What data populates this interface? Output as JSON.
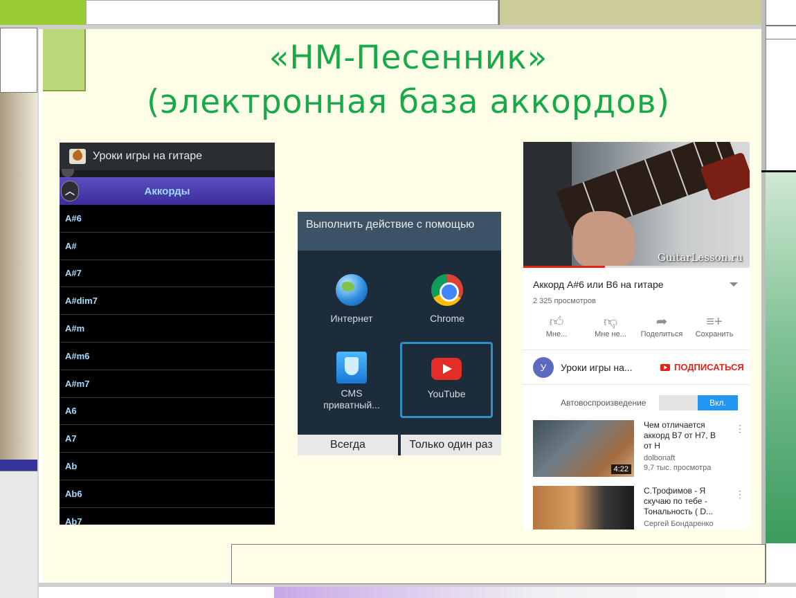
{
  "slide": {
    "title_line1": "«НМ-Песенник»",
    "title_line2": "(электронная база аккордов)"
  },
  "chords_app": {
    "app_title": "Уроки игры на гитаре",
    "section_header": "Аккорды",
    "chords": [
      "A#6",
      "A#",
      "A#7",
      "A#dim7",
      "A#m",
      "A#m6",
      "A#m7",
      "A6",
      "A7",
      "Ab",
      "Ab6",
      "Ab7"
    ]
  },
  "share_dialog": {
    "heading": "Выполнить действие с помощью",
    "apps": [
      {
        "label": "Интернет",
        "icon": "browser-globe-icon"
      },
      {
        "label": "Chrome",
        "icon": "chrome-icon"
      },
      {
        "label": "CMS приватный...",
        "icon": "shield-icon"
      },
      {
        "label": "YouTube",
        "icon": "youtube-icon"
      }
    ],
    "buttons": {
      "always": "Всегда",
      "once": "Только один раз"
    }
  },
  "youtube": {
    "watermark": "GuitarLesson.ru",
    "video_title": "Аккорд A#6 или B6 на гитаре",
    "views": "2 325 просмотров",
    "actions": [
      {
        "label": "Мне...",
        "icon": "thumbs-up-icon"
      },
      {
        "label": "Мне не...",
        "icon": "thumbs-down-icon"
      },
      {
        "label": "Поделиться",
        "icon": "share-icon"
      },
      {
        "label": "Сохранить",
        "icon": "add-to-playlist-icon"
      }
    ],
    "channel": {
      "avatar_letter": "У",
      "name": "Уроки игры на...",
      "subscribe": "ПОДПИСАТЬСЯ"
    },
    "autoplay": {
      "label": "Автовоспроизведение",
      "state": "Вкл."
    },
    "recommended": [
      {
        "title": "Чем отличается аккорд B7 от H7, B от H",
        "channel": "dolbonaft",
        "views": "9,7 тыс. просмотра",
        "duration": "4:22"
      },
      {
        "title": "С.Трофимов - Я скучаю по тебе - Тональность ( D...",
        "channel": "Сергей Бондаренко"
      }
    ],
    "colors": {
      "accent": "#e62117",
      "toggle_on": "#2196f3"
    }
  }
}
